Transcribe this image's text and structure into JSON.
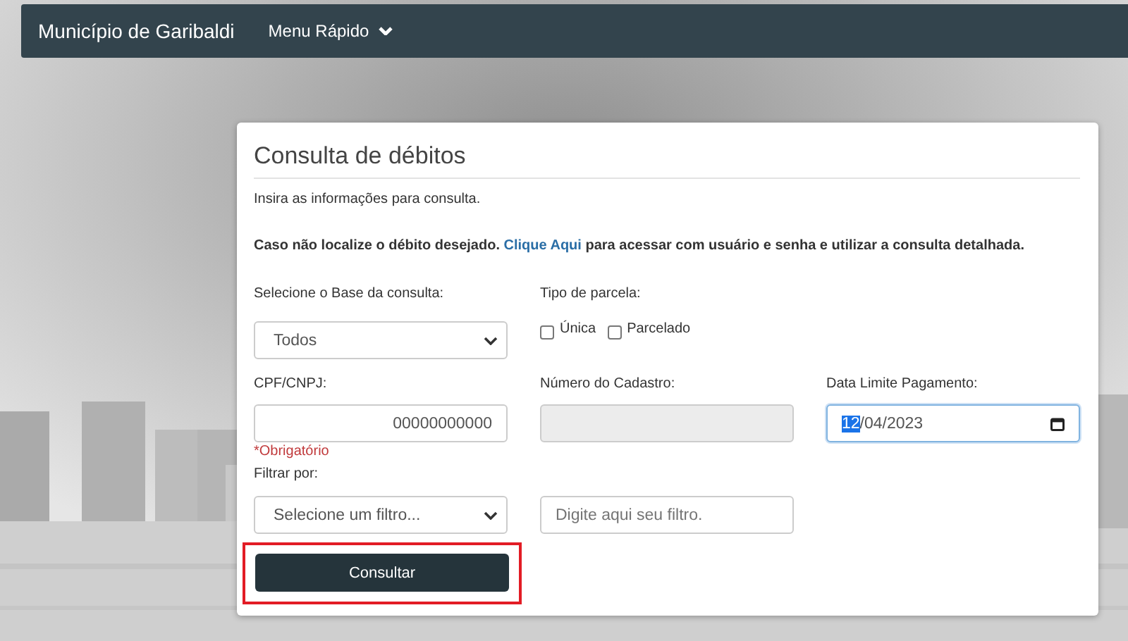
{
  "navbar": {
    "brand": "Município de Garibaldi",
    "menu": "Menu Rápido"
  },
  "form": {
    "title": "Consulta de débitos",
    "intro": "Insira as informações para consulta.",
    "notice": {
      "before": "Caso não localize o débito desejado.",
      "link": "Clique Aqui",
      "after": "para acessar com usuário e senha e utilizar a consulta detalhada."
    },
    "base": {
      "label": "Selecione o Base da consulta:",
      "value": "Todos"
    },
    "parcela": {
      "label": "Tipo de parcela:",
      "options": [
        {
          "label": "Única",
          "checked": false
        },
        {
          "label": "Parcelado",
          "checked": false
        }
      ]
    },
    "cpf": {
      "label": "CPF/CNPJ:",
      "value": "00000000000",
      "required_note": "*Obrigatório"
    },
    "cadastro": {
      "label": "Número do Cadastro:",
      "disabled": true
    },
    "data_limite": {
      "label": "Data Limite Pagamento:",
      "value": "12/04/2023",
      "focused": true
    },
    "filtro": {
      "label": "Filtrar por:",
      "select_value": "Selecione um filtro...",
      "placeholder": "Digite aqui seu filtro."
    },
    "submit": {
      "label": "Consultar",
      "highlighted": true
    }
  }
}
